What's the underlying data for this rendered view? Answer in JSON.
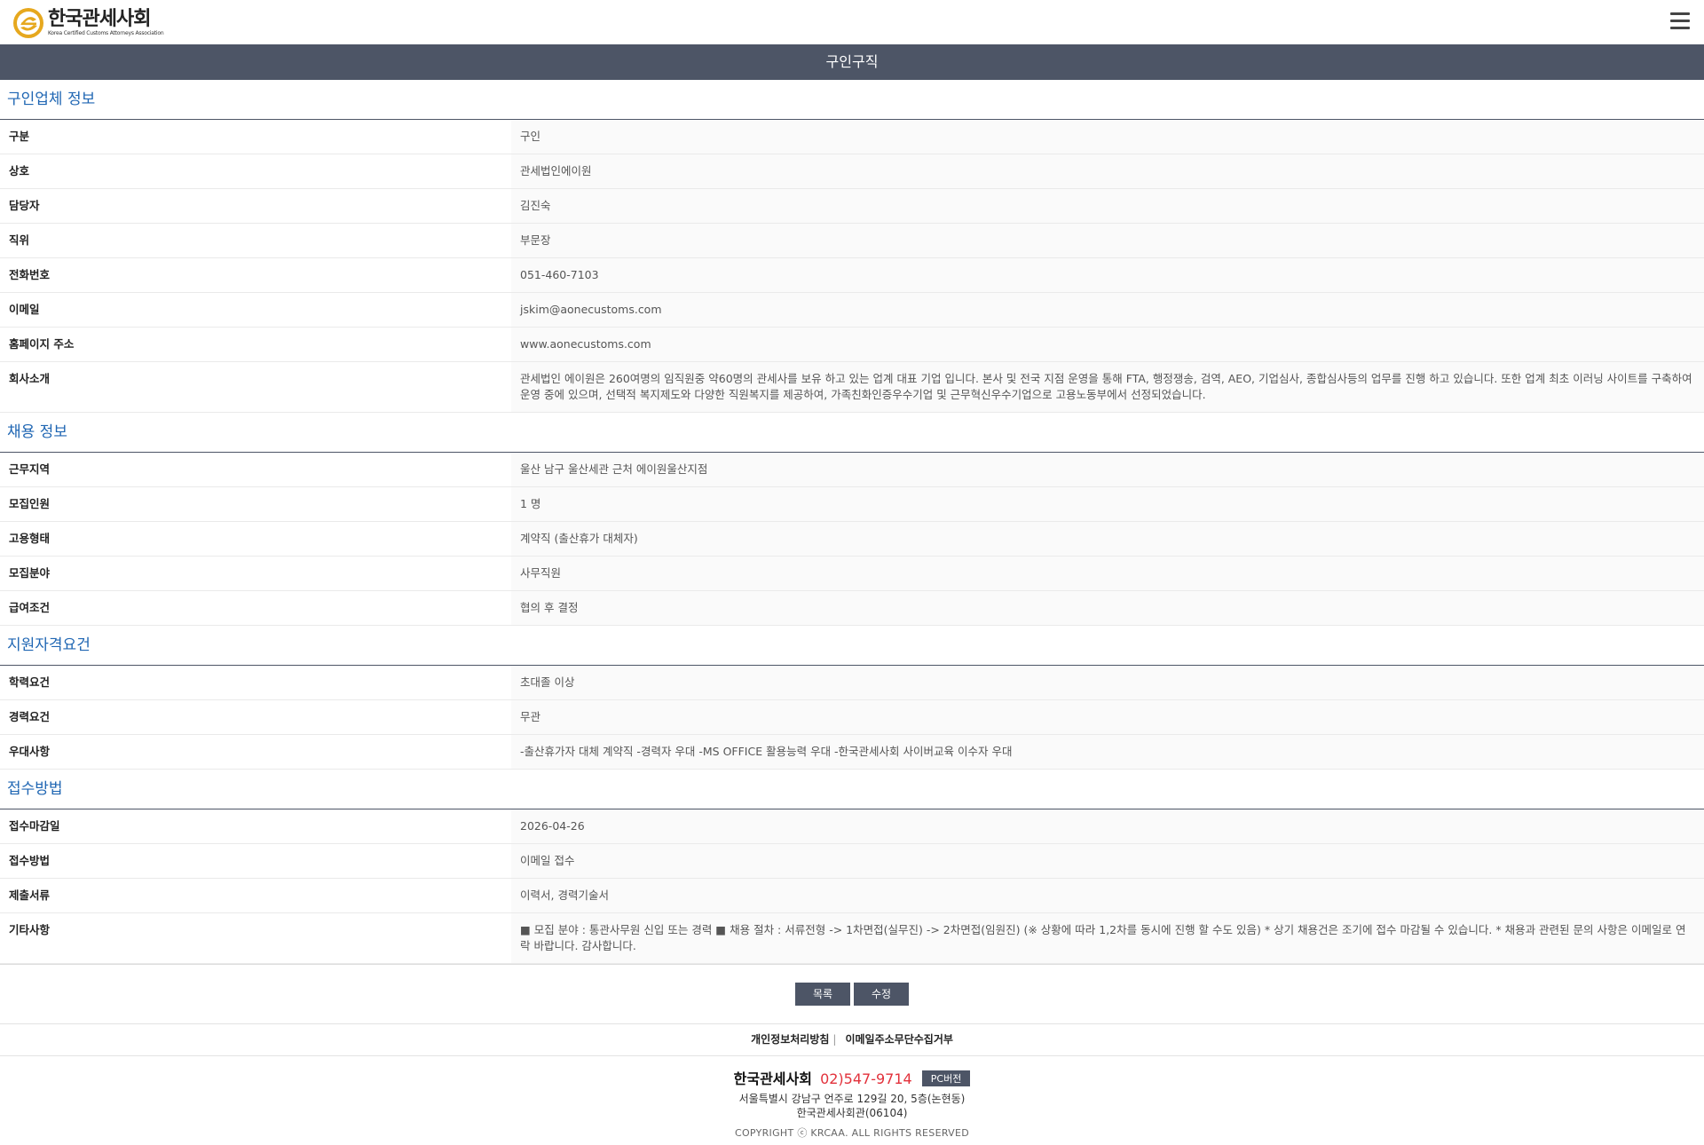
{
  "header": {
    "logo_ko": "한국관세사회",
    "logo_en": "Korea Certified Customs Attorneys Association"
  },
  "page_title": "구인구직",
  "sections": [
    {
      "title": "구인업체 정보",
      "rows": [
        {
          "label": "구분",
          "value": "구인"
        },
        {
          "label": "상호",
          "value": "관세법인에이원"
        },
        {
          "label": "담당자",
          "value": "김진숙"
        },
        {
          "label": "직위",
          "value": "부문장"
        },
        {
          "label": "전화번호",
          "value": "051-460-7103"
        },
        {
          "label": "이메일",
          "value": "jskim@aonecustoms.com"
        },
        {
          "label": "홈페이지 주소",
          "value": "www.aonecustoms.com"
        },
        {
          "label": "회사소개",
          "value": "관세법인 에이원은 260여명의 임직원중 약60명의 관세사를 보유 하고 있는 업계 대표 기업 입니다. 본사 및 전국 지점 운영을 통해 FTA, 행정쟁송, 검역, AEO, 기업심사, 종합심사등의 업무를 진행 하고 있습니다. 또한 업계 최초 이러닝 사이트를 구축하여 운영 중에 있으며, 선택적 복지제도와 다양한 직원복지를 제공하여, 가족친화인증우수기업 및 근무혁신우수기업으로 고용노동부에서 선정되었습니다."
        }
      ]
    },
    {
      "title": "채용 정보",
      "rows": [
        {
          "label": "근무지역",
          "value": "울산 남구 울산세관 근처 에이원울산지점"
        },
        {
          "label": "모집인원",
          "value": "1 명"
        },
        {
          "label": "고용형태",
          "value": "계약직 (출산휴가 대체자)"
        },
        {
          "label": "모집분야",
          "value": "사무직원"
        },
        {
          "label": "급여조건",
          "value": "협의 후 결정"
        }
      ]
    },
    {
      "title": "지원자격요건",
      "rows": [
        {
          "label": "학력요건",
          "value": "초대졸 이상"
        },
        {
          "label": "경력요건",
          "value": "무관"
        },
        {
          "label": "우대사항",
          "value": "-출산휴가자 대체 계약직 -경력자 우대 -MS OFFICE 활용능력 우대 -한국관세사회 사이버교육 이수자 우대"
        }
      ]
    },
    {
      "title": "접수방법",
      "rows": [
        {
          "label": "접수마감일",
          "value": "2026-04-26"
        },
        {
          "label": "접수방법",
          "value": "이메일 접수"
        },
        {
          "label": "제출서류",
          "value": "이력서, 경력기술서"
        },
        {
          "label": "기타사항",
          "value": "■ 모집 분야 : 통관사무원 신입 또는 경력 ■ 채용 절차 : 서류전형 -> 1차면접(실무진) -> 2차면접(임원진) (※ 상황에 따라 1,2차를 동시에 진행 할 수도 있음) * 상기 채용건은 조기에 접수 마감될 수 있습니다. * 채용과 관련된 문의 사항은 이메일로 연락 바랍니다. 감사합니다."
        }
      ]
    }
  ],
  "buttons": {
    "list": "목록",
    "edit": "수정"
  },
  "footer": {
    "privacy": "개인정보처리방침",
    "separator": "|",
    "email_refuse": "이메일주소무단수집거부",
    "org_name": "한국관세사회",
    "phone": "02)547-9714",
    "pc_version": "PC버전",
    "address1": "서울특별시 강남구 언주로 129길 20, 5층(논현동)",
    "address2": "한국관세사회관(06104)",
    "copyright": "COPYRIGHT ⓒ KRCAA. ALL RIGHTS RESERVED"
  },
  "colors": {
    "accent": "#4d5566",
    "title_blue": "#1f66b3",
    "phone_red": "#e2313b",
    "logo_gold": "#e6a81e"
  }
}
